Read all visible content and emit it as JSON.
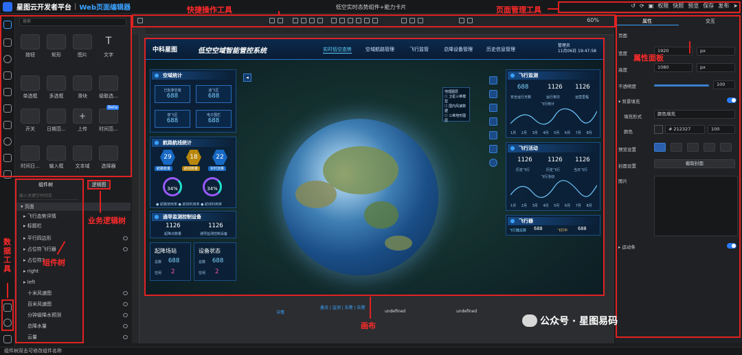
{
  "app": {
    "title": "星图云开发者平台",
    "subtitle": "Web页面编辑器",
    "doc_title": "低空实时态势组件+能力卡片"
  },
  "topbar": {
    "buttons": [
      "权限",
      "快照",
      "预览",
      "保存",
      "发布"
    ]
  },
  "toolbar": {
    "zoom": "60%"
  },
  "components": {
    "search_placeholder": "搜索",
    "items": [
      "按钮",
      "矩形",
      "图片",
      "文字",
      "单选框",
      "多选框",
      "滑块",
      "级联选...",
      "开关",
      "日期范...",
      "上传",
      "时间范...",
      "时间日...",
      "输入框",
      "文本域",
      "选择器"
    ],
    "beta": "Beta"
  },
  "tree": {
    "tab": "组件树",
    "logic_tab": "逻辑图",
    "search_placeholder": "输入关键字并回车",
    "rows": [
      "页面",
      "飞行态势评情",
      "标题栏",
      "平行四边形",
      "占位符飞行器",
      "占位符1",
      "right",
      "left",
      "十米风速图",
      "百米风速图",
      "分钟级降水预测",
      "总降水量",
      "云量"
    ]
  },
  "dashboard": {
    "logo": "中科星图",
    "title": "低空空域智能管控系统",
    "nav": [
      "实时低空态势",
      "空域航路管理",
      "飞行监管",
      "总降设备管理",
      "历史信息管理"
    ],
    "user": "管理员",
    "user_time": "11月06日 19:47:58",
    "p1": {
      "title": "空域统计",
      "stats": [
        {
          "l": "已批准空域",
          "v": "688"
        },
        {
          "l": "适飞区",
          "v": "688"
        },
        {
          "l": "禁飞区",
          "v": "688"
        },
        {
          "l": "电子围栏",
          "v": "688"
        }
      ]
    },
    "p2": {
      "title": "航路航线统计",
      "hex": [
        {
          "v": "29",
          "l": "航路数量"
        },
        {
          "v": "18",
          "l": "航线数量"
        },
        {
          "v": "22",
          "l": "实时流量"
        }
      ],
      "rings": [
        {
          "v": "34%",
          "l": "航路利用率"
        },
        {
          "v": "34%",
          "l": "占用航线"
        }
      ],
      "legend": "● 航路使用率  ● 航线利用率  ● 航线利用率"
    },
    "p3": {
      "title": "通导监测控制设备",
      "a_v": "1126",
      "a_l": "起降点数量",
      "b_v": "1126",
      "b_l": "通导监测控制设备"
    },
    "p4": {
      "a_title": "起降场站",
      "b_title": "设备状态",
      "a_r1": "总数",
      "a_r2": "空闲",
      "b_r1": "总数",
      "b_r2": "空闲",
      "v1": "688",
      "v2": "2"
    },
    "mapbox": {
      "title": "地理图层",
      "items": [
        "卫星三维模型",
        "国内风速数据",
        "三维地形图层"
      ]
    },
    "r1": {
      "title": "飞行监测",
      "a": "688",
      "a_l": "安全运行天数",
      "b": "1126",
      "b_l": "运行架次",
      "c": "1126",
      "c_l": "运营里程",
      "chart_l": "飞行统计",
      "x": [
        "1月",
        "2月",
        "3月",
        "4月",
        "5月",
        "6月",
        "7月",
        "8月"
      ]
    },
    "r2": {
      "title": "飞行活动",
      "a": "1126",
      "a_l": "历史飞行",
      "b": "1126",
      "b_l": "历史飞行",
      "c": "1126",
      "c_l": "当日飞行",
      "chart_l": "飞行活动"
    },
    "r3": {
      "title": "飞行器",
      "a_l": "飞行器总数",
      "a": "688",
      "b_l": "飞行中",
      "b": "688"
    }
  },
  "canvas_bottom": {
    "left": "详情",
    "mid": "叠流 | 监测 | 告警 | 告警",
    "u1": "undefined",
    "u2": "undefined"
  },
  "props": {
    "tabs": [
      "属性",
      "交互"
    ],
    "page": "页面",
    "width_l": "宽度",
    "width": "1920",
    "height_l": "高度",
    "height": "1080",
    "unit": "px",
    "opacity_l": "不透明度",
    "opacity": "100",
    "pct": "%",
    "bg_fill": "背景填充",
    "fill_mode_l": "填充形式",
    "fill_mode": "颜色填充",
    "color_l": "颜色",
    "color": "# 212327",
    "color_pct": "100",
    "preview_l": "预览设置",
    "cover_l": "封面设置",
    "cover_btn": "截取封面",
    "image_l": "图片",
    "motion": "运动条"
  },
  "status": "组件树双击可修改组件名称",
  "annotations": {
    "quick": "快捷操作工具",
    "page_mgmt": "页面管理工具",
    "prop": "属性面板",
    "logic": "业务逻辑树",
    "tree": "组件树",
    "canvas": "画布",
    "data_tool": "数据工具"
  },
  "watermark": "公众号 · 星图易码"
}
